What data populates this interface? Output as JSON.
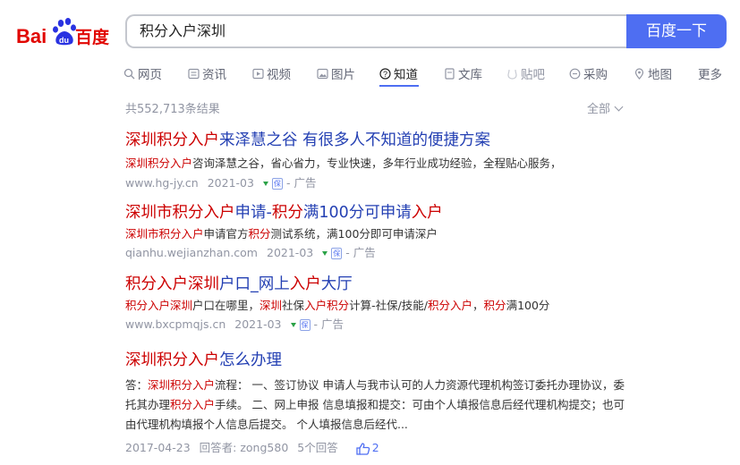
{
  "logo": {
    "text_left": "Bai",
    "text_right": "百度",
    "paw_text": "du"
  },
  "search": {
    "query": "积分入户深圳",
    "button_label": "百度一下"
  },
  "tabs": [
    {
      "label": "网页",
      "icon": "web-page-icon"
    },
    {
      "label": "资讯",
      "icon": "news-icon"
    },
    {
      "label": "视频",
      "icon": "video-icon"
    },
    {
      "label": "图片",
      "icon": "image-icon"
    },
    {
      "label": "知道",
      "icon": "question-icon"
    },
    {
      "label": "文库",
      "icon": "document-icon"
    },
    {
      "label": "贴吧",
      "icon": "forum-icon"
    },
    {
      "label": "采购",
      "icon": "purchase-icon"
    },
    {
      "label": "地图",
      "icon": "map-icon"
    },
    {
      "label": "更多",
      "icon": ""
    }
  ],
  "result_count": "共552,713条结果",
  "filter_label": "全部",
  "results": [
    {
      "title": [
        [
          "深圳积分入户",
          true
        ],
        [
          "来泽慧之谷 有很多人不知道的便捷方案",
          false
        ]
      ],
      "desc": [
        [
          "深圳积分入户",
          true
        ],
        [
          "咨询泽慧之谷，省心省力，专业快速，多年行业成功经验，全程贴心服务，",
          false
        ]
      ],
      "url": "www.hg-jy.cn",
      "date": "2021-03",
      "ad": "- 广告"
    },
    {
      "title": [
        [
          "深圳市积分入户",
          true
        ],
        [
          "申请-",
          false
        ],
        [
          "积分",
          true
        ],
        [
          "满100分可申请",
          false
        ],
        [
          "入户",
          true
        ]
      ],
      "desc": [
        [
          "深圳市积分入户",
          true
        ],
        [
          "申请官方",
          false
        ],
        [
          "积分",
          true
        ],
        [
          "测试系统，满100分即可申请深户",
          false
        ]
      ],
      "url": "qianhu.wejianzhan.com",
      "date": "2021-03",
      "ad": "- 广告"
    },
    {
      "title": [
        [
          "积分入户深圳",
          true
        ],
        [
          "户口_网上",
          false
        ],
        [
          "入户",
          true
        ],
        [
          "大厅",
          false
        ]
      ],
      "desc": [
        [
          "积分入户深圳",
          true
        ],
        [
          "户口在哪里，",
          false
        ],
        [
          "深圳",
          true
        ],
        [
          "社保",
          false
        ],
        [
          "入户积分",
          true
        ],
        [
          "计算-社保/技能/",
          false
        ],
        [
          "积分入户",
          true
        ],
        [
          "，",
          false
        ],
        [
          "积分",
          true
        ],
        [
          "满100分",
          false
        ]
      ],
      "url": "www.bxcpmqjs.cn",
      "date": "2021-03",
      "ad": "- 广告"
    }
  ],
  "answer": {
    "title": [
      [
        "深圳积分入户",
        true
      ],
      [
        "怎么办理",
        false
      ]
    ],
    "desc": [
      [
        "答：",
        false
      ],
      [
        "深圳积分入户",
        true
      ],
      [
        "流程： 一、签订协议 申请人与我市认可的人力资源代理机构签订委托办理协议，委托其办理",
        false
      ],
      [
        "积分入户",
        true
      ],
      [
        "手续。 二、网上申报 信息填报和提交：可由个人填报信息后经代理机构提交；也可由代理机构填报个人信息后提交。 个人填报信息后经代...",
        false
      ]
    ],
    "date": "2017-04-23",
    "answerer": "回答者: zong580",
    "answers": "5个回答",
    "likes": "2"
  },
  "colors": {
    "brand_blue": "#4e6ef2",
    "link_blue": "#2440b3",
    "highlight_red": "#cc0000",
    "meta_gray": "#9195a3"
  }
}
